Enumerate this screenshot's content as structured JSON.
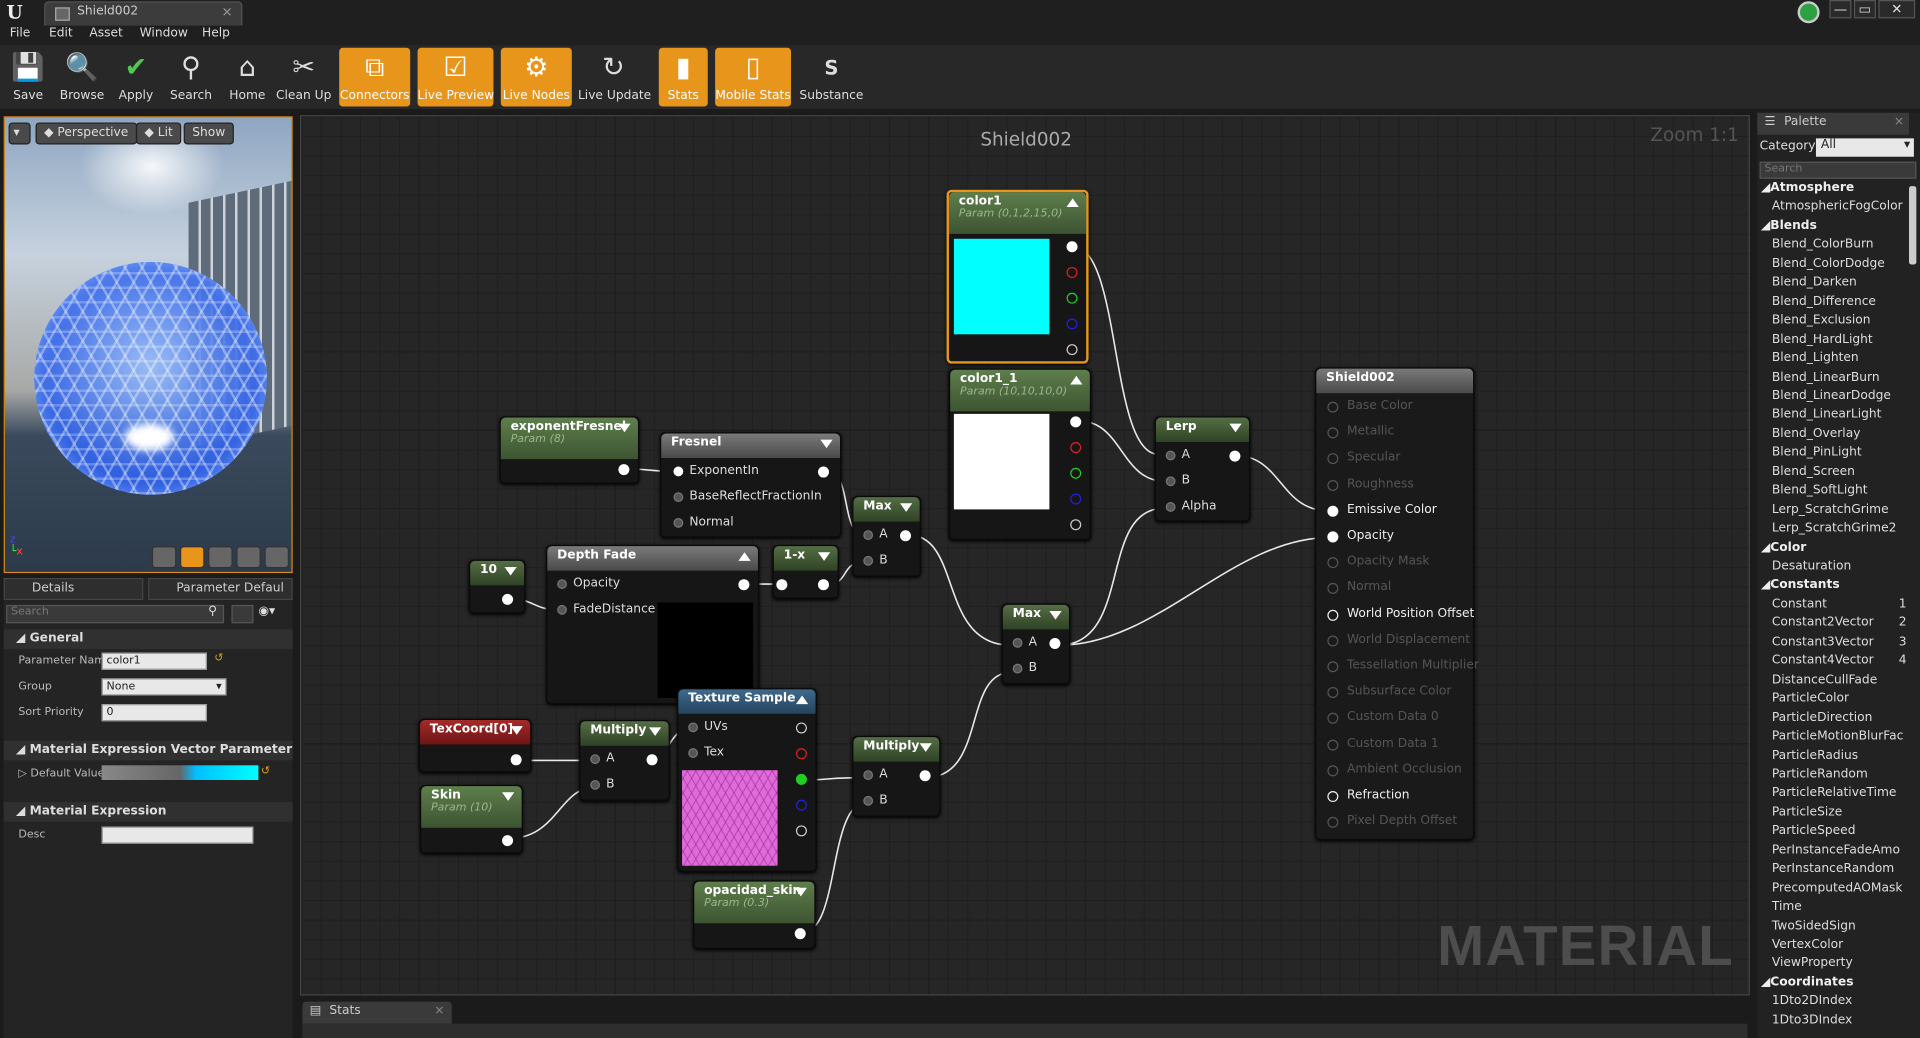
{
  "window": {
    "tab_title": "Shield002",
    "minimize": "—",
    "restore": "▭",
    "close": "✕"
  },
  "menu": [
    "File",
    "Edit",
    "Asset",
    "Window",
    "Help"
  ],
  "toolbar": [
    {
      "label": "Save",
      "icon": "💾",
      "on": false
    },
    {
      "label": "Browse",
      "icon": "🔍",
      "on": false
    },
    {
      "label": "Apply",
      "icon": "✔",
      "on": false
    },
    {
      "label": "Search",
      "icon": "⚲",
      "on": false
    },
    {
      "label": "Home",
      "icon": "⌂",
      "on": false
    },
    {
      "label": "Clean Up",
      "icon": "✂",
      "on": false
    },
    {
      "label": "Connectors",
      "icon": "⧉",
      "on": true
    },
    {
      "label": "Live Preview",
      "icon": "☑",
      "on": true
    },
    {
      "label": "Live Nodes",
      "icon": "⚙",
      "on": true
    },
    {
      "label": "Live Update",
      "icon": "↻",
      "on": false
    },
    {
      "label": "Stats",
      "icon": "▮",
      "on": true
    },
    {
      "label": "Mobile Stats",
      "icon": "▯",
      "on": true
    },
    {
      "label": "Substance",
      "icon": "S",
      "on": false
    }
  ],
  "viewport": {
    "perspective": "Perspective",
    "lit": "Lit",
    "show": "Show",
    "axis_x": "x",
    "axis_z": "z"
  },
  "details": {
    "tab_details": "Details",
    "tab_param": "Parameter Defaul",
    "search_placeholder": "Search",
    "general": "General",
    "param_name_label": "Parameter Nam",
    "param_name_value": "color1",
    "group_label": "Group",
    "group_value": "None",
    "sort_label": "Sort Priority",
    "sort_value": "0",
    "vector_section": "Material Expression Vector Parameter",
    "default_value_label": "Default Value",
    "mat_expr_section": "Material Expression",
    "desc_label": "Desc"
  },
  "graph": {
    "title": "Shield002",
    "zoom": "Zoom 1:1",
    "watermark": "MATERIAL"
  },
  "nodes": {
    "color1": {
      "title": "color1",
      "sub": "Param (0,1,2,15,0)",
      "swatch": "#00ffff"
    },
    "color1_1": {
      "title": "color1_1",
      "sub": "Param (10,10,10,0)",
      "swatch": "#ffffff"
    },
    "exponentFresnel": {
      "title": "exponentFresnel",
      "sub": "Param (8)"
    },
    "fresnel": {
      "title": "Fresnel",
      "pins": [
        "ExponentIn",
        "BaseReflectFractionIn",
        "Normal"
      ]
    },
    "max1": {
      "title": "Max",
      "a": "A",
      "b": "B"
    },
    "ten": {
      "title": "10"
    },
    "depthfade": {
      "title": "Depth Fade",
      "opacity": "Opacity",
      "fade": "FadeDistance"
    },
    "oneminus": {
      "title": "1-x"
    },
    "lerp": {
      "title": "Lerp",
      "a": "A",
      "b": "B",
      "alpha": "Alpha"
    },
    "max2": {
      "title": "Max",
      "a": "A",
      "b": "B"
    },
    "texcoord": {
      "title": "TexCoord[0]"
    },
    "multiply1": {
      "title": "Multiply",
      "a": "A",
      "b": "B"
    },
    "texsample": {
      "title": "Texture Sample",
      "uvs": "UVs",
      "tex": "Tex"
    },
    "multiply2": {
      "title": "Multiply",
      "a": "A",
      "b": "B"
    },
    "skin": {
      "title": "Skin",
      "sub": "Param (10)"
    },
    "opacidad": {
      "title": "opacidad_skin",
      "sub": "Param (0.3)"
    },
    "result": {
      "title": "Shield002",
      "pins": [
        {
          "label": "Base Color",
          "on": false
        },
        {
          "label": "Metallic",
          "on": false
        },
        {
          "label": "Specular",
          "on": false
        },
        {
          "label": "Roughness",
          "on": false
        },
        {
          "label": "Emissive Color",
          "on": true
        },
        {
          "label": "Opacity",
          "on": true
        },
        {
          "label": "Opacity Mask",
          "on": false
        },
        {
          "label": "Normal",
          "on": false
        },
        {
          "label": "World Position Offset",
          "on": "hollow"
        },
        {
          "label": "World Displacement",
          "on": false
        },
        {
          "label": "Tessellation Multiplier",
          "on": false
        },
        {
          "label": "Subsurface Color",
          "on": false
        },
        {
          "label": "Custom Data 0",
          "on": false
        },
        {
          "label": "Custom Data 1",
          "on": false
        },
        {
          "label": "Ambient Occlusion",
          "on": false
        },
        {
          "label": "Refraction",
          "on": "hollow"
        },
        {
          "label": "Pixel Depth Offset",
          "on": false
        }
      ]
    }
  },
  "bottom": {
    "stats_tab": "Stats"
  },
  "palette": {
    "tab": "Palette",
    "category_label": "Category:",
    "category_value": "All",
    "search_placeholder": "Search",
    "items": [
      {
        "t": "Atmosphere",
        "cat": true
      },
      {
        "t": "AtmosphericFogColor"
      },
      {
        "t": "Blends",
        "cat": true
      },
      {
        "t": "Blend_ColorBurn"
      },
      {
        "t": "Blend_ColorDodge"
      },
      {
        "t": "Blend_Darken"
      },
      {
        "t": "Blend_Difference"
      },
      {
        "t": "Blend_Exclusion"
      },
      {
        "t": "Blend_HardLight"
      },
      {
        "t": "Blend_Lighten"
      },
      {
        "t": "Blend_LinearBurn"
      },
      {
        "t": "Blend_LinearDodge"
      },
      {
        "t": "Blend_LinearLight"
      },
      {
        "t": "Blend_Overlay"
      },
      {
        "t": "Blend_PinLight"
      },
      {
        "t": "Blend_Screen"
      },
      {
        "t": "Blend_SoftLight"
      },
      {
        "t": "Lerp_ScratchGrime"
      },
      {
        "t": "Lerp_ScratchGrime2"
      },
      {
        "t": "Color",
        "cat": true
      },
      {
        "t": "Desaturation"
      },
      {
        "t": "Constants",
        "cat": true
      },
      {
        "t": "Constant",
        "n": "1"
      },
      {
        "t": "Constant2Vector",
        "n": "2"
      },
      {
        "t": "Constant3Vector",
        "n": "3"
      },
      {
        "t": "Constant4Vector",
        "n": "4"
      },
      {
        "t": "DistanceCullFade"
      },
      {
        "t": "ParticleColor"
      },
      {
        "t": "ParticleDirection"
      },
      {
        "t": "ParticleMotionBlurFac"
      },
      {
        "t": "ParticleRadius"
      },
      {
        "t": "ParticleRandom"
      },
      {
        "t": "ParticleRelativeTime"
      },
      {
        "t": "ParticleSize"
      },
      {
        "t": "ParticleSpeed"
      },
      {
        "t": "PerInstanceFadeAmo"
      },
      {
        "t": "PerInstanceRandom"
      },
      {
        "t": "PrecomputedAOMask"
      },
      {
        "t": "Time"
      },
      {
        "t": "TwoSidedSign"
      },
      {
        "t": "VertexColor"
      },
      {
        "t": "ViewProperty"
      },
      {
        "t": "Coordinates",
        "cat": true
      },
      {
        "t": "1Dto2DIndex"
      },
      {
        "t": "1Dto3DIndex"
      }
    ]
  }
}
